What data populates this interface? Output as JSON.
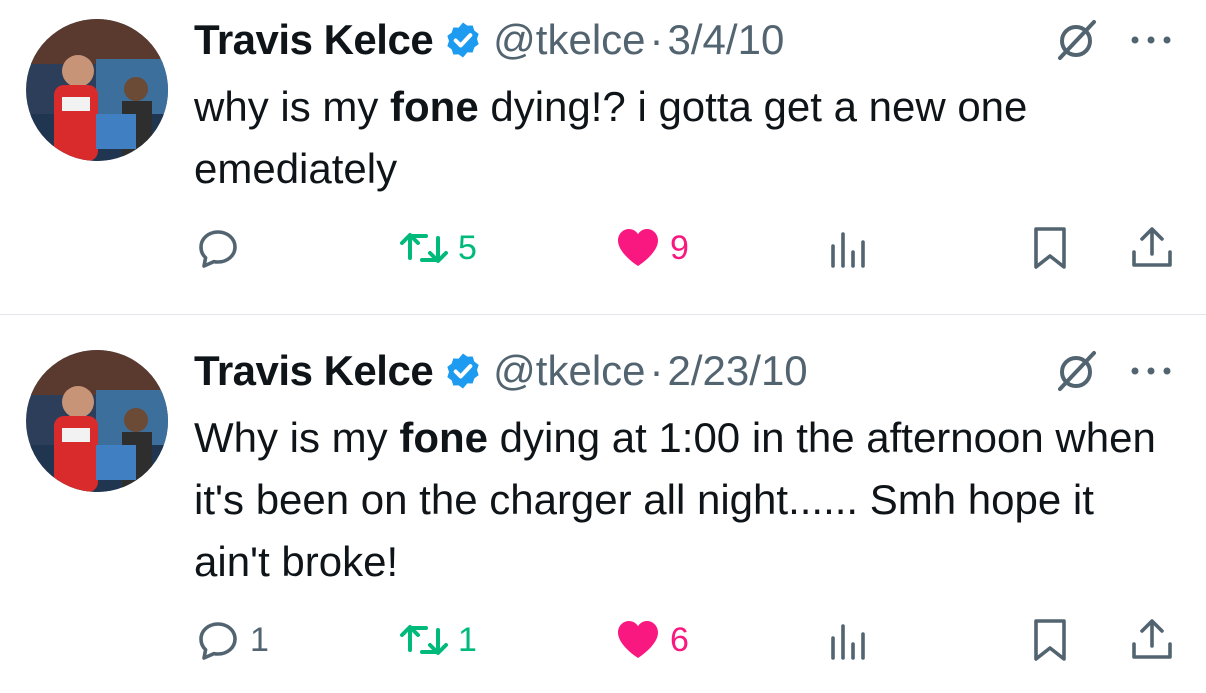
{
  "colors": {
    "retweet": "#00ba7c",
    "like": "#f91880",
    "muted": "#536471",
    "verified": "#1d9bf0"
  },
  "tweets": [
    {
      "author_name": "Travis Kelce",
      "handle": "@tkelce",
      "separator": "·",
      "date": "3/4/10",
      "text_before": "why is my ",
      "text_bold": "fone",
      "text_after": " dying!? i gotta get a new one emediately",
      "replies": "",
      "retweets": "5",
      "likes": "9"
    },
    {
      "author_name": "Travis Kelce",
      "handle": "@tkelce",
      "separator": "·",
      "date": "2/23/10",
      "text_before": "Why is my ",
      "text_bold": "fone",
      "text_after": " dying at 1:00 in the afternoon when it's been on the charger all night...... Smh hope it ain't broke!",
      "replies": "1",
      "retweets": "1",
      "likes": "6"
    }
  ]
}
